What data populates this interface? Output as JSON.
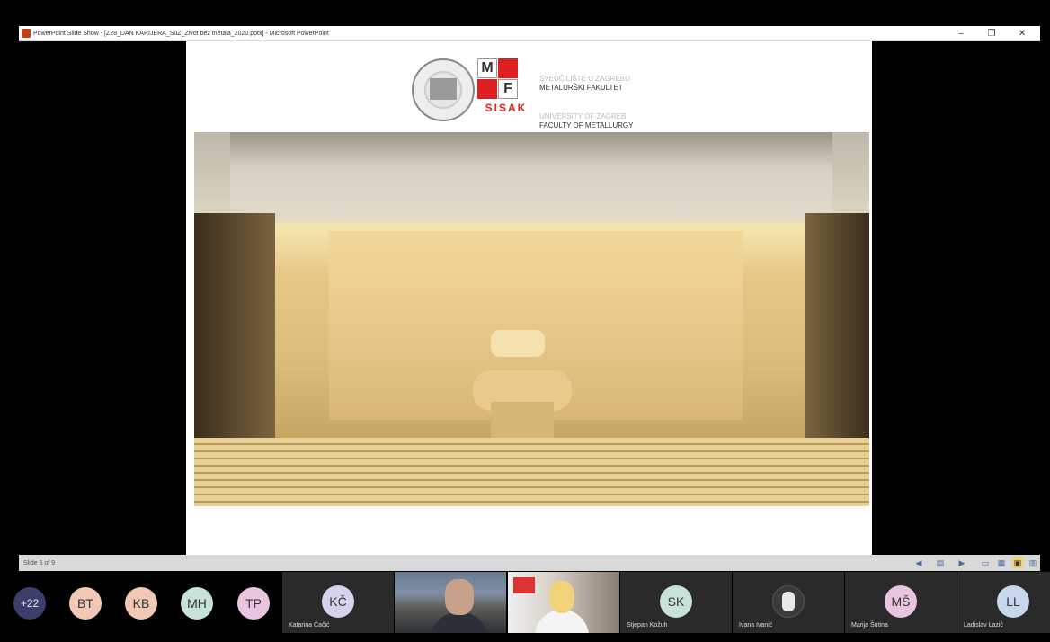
{
  "window": {
    "title": "PowerPoint Slide Show - [Z28_DAN KARIJERA_SuZ_Zivot bez metala_2020.pptx] - Microsoft PowerPoint",
    "minimize": "–",
    "maximize": "❐",
    "close": "✕"
  },
  "slide": {
    "logo": {
      "mf_m": "M",
      "mf_f": "F",
      "sisak": "SISAK",
      "line1": "SVEUČILIŠTE U ZAGREBU",
      "line2": "METALURŠKI FAKULTET",
      "line3": "UNIVERSITY OF ZAGREB",
      "line4": "FACULTY OF METALLURGY"
    }
  },
  "statusbar": {
    "slide_counter": "Slide 6 of 9",
    "icons": [
      "prev-icon",
      "notes-icon",
      "next-icon",
      "normal-view-icon",
      "sorter-view-icon",
      "reading-view-icon",
      "slideshow-icon"
    ]
  },
  "participants": {
    "more": "+22",
    "avatars": {
      "bt": "BT",
      "kb": "KB",
      "mh": "MH",
      "tp": "TP"
    },
    "tiles": {
      "kc": {
        "initials": "KČ",
        "name": "Katarina Čačić"
      },
      "sk": {
        "initials": "SK",
        "name": "Stjepan Kožuh"
      },
      "ii": {
        "name": "Ivana Ivanić"
      },
      "ms": {
        "initials": "MŠ",
        "name": "Marija Šutina"
      },
      "ll": {
        "initials": "LL",
        "name": "Ladislav Lazić"
      }
    },
    "colors": {
      "more": "#3b3f6b",
      "bt": "#f0c8b4",
      "mh": "#c7e2d6",
      "tp": "#e8c4e0",
      "kc": "#d6d2ee",
      "ll": "#c9d7ec"
    }
  }
}
